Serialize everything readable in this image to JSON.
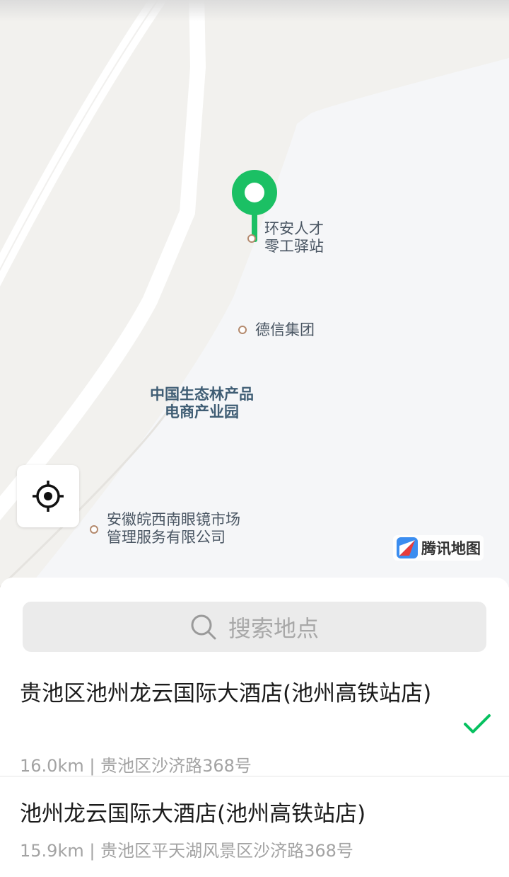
{
  "map": {
    "pois": [
      {
        "name": "环安人才\n零工驿站"
      },
      {
        "name": "德信集团"
      },
      {
        "name": "安徽皖西南眼镜市场\n管理服务有限公司"
      }
    ],
    "area_label": "中国生态林产品\n电商产业园",
    "brand": "腾讯地图",
    "icons": {
      "pin": "location-pin-icon",
      "locate": "locate-icon",
      "brand": "tencent-map-logo-icon"
    },
    "colors": {
      "pin": "#1bc064",
      "map_bg": "#f2f1ee",
      "area_bg": "#f5f6f8"
    }
  },
  "search": {
    "placeholder": "搜索地点",
    "icon": "search-icon"
  },
  "results": [
    {
      "title": "贵池区池州龙云国际大酒店(池州高铁站店)",
      "distance": "16.0km",
      "address": "贵池区沙济路368号",
      "selected": true
    },
    {
      "title": "池州龙云国际大酒店(池州高铁站店)",
      "distance": "15.9km",
      "address": "贵池区平天湖风景区沙济路368号",
      "selected": false
    }
  ],
  "accent_color": "#07c160"
}
